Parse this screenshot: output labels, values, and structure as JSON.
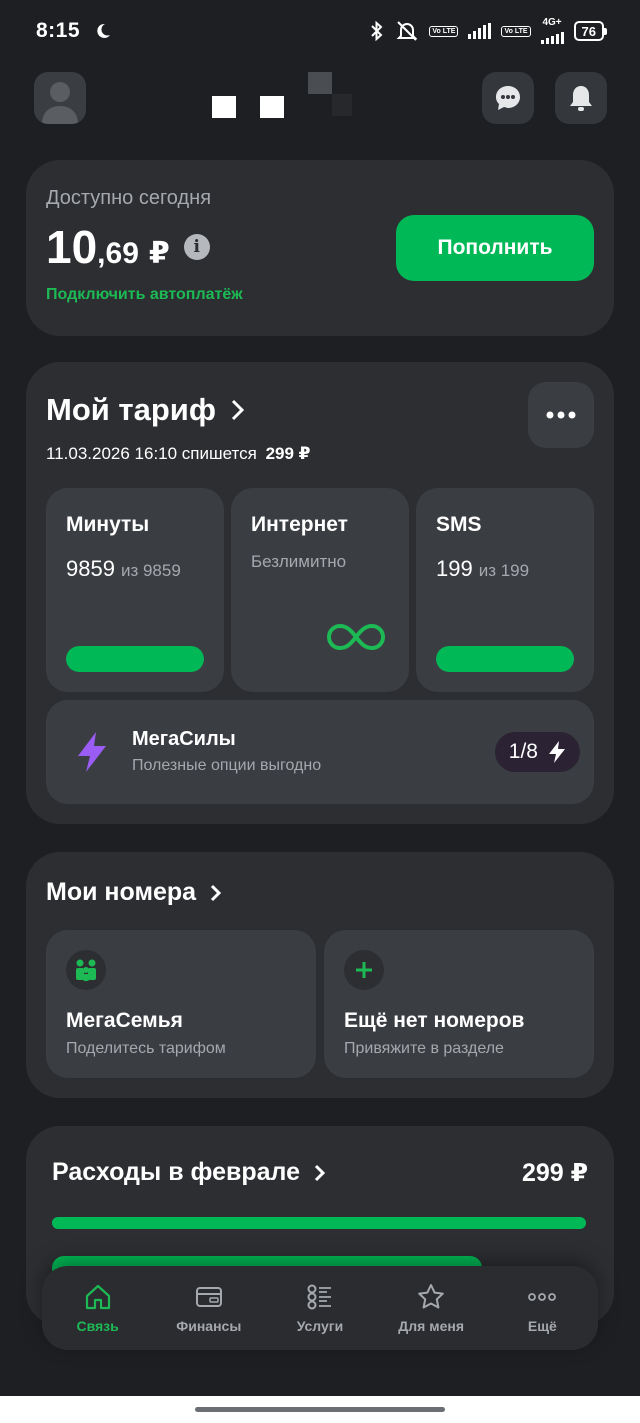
{
  "status_bar": {
    "time": "8:15",
    "volte_1": "Vo LTE",
    "volte_2": "Vo LTE",
    "network": "4G+",
    "battery": "76"
  },
  "header": {
    "avatar_icon": "user-avatar-icon",
    "chat_icon": "chat-bubble-icon",
    "bell_icon": "bell-icon"
  },
  "balance": {
    "label": "Доступно сегодня",
    "amount_int": "10",
    "amount_frac": ",69",
    "currency": "₽",
    "info": "i",
    "autopay_link": "Подключить автоплатёж",
    "topup_label": "Пополнить"
  },
  "tariff": {
    "title": "Мой тариф",
    "charge_text": "11.03.2026 16:10 спишется",
    "charge_amount": "299 ₽",
    "minutes": {
      "title": "Минуты",
      "value": "9859",
      "total": "из 9859",
      "fill": 1.0
    },
    "internet": {
      "title": "Интернет",
      "value": "Безлимитно"
    },
    "sms": {
      "title": "SMS",
      "value": "199",
      "total": "из 199",
      "fill": 1.0
    },
    "megasily": {
      "title": "МегаСилы",
      "subtitle": "Полезные опции выгодно",
      "badge": "1/8"
    }
  },
  "numbers": {
    "title": "Мои номера",
    "family": {
      "title": "МегаСемья",
      "subtitle": "Поделитесь тарифом"
    },
    "add": {
      "title": "Ещё нет номеров",
      "subtitle": "Привяжите в разделе"
    }
  },
  "expenses": {
    "title": "Расходы в феврале",
    "amount": "299 ₽"
  },
  "tabs": [
    {
      "label": "Связь",
      "icon": "home-icon",
      "active": true
    },
    {
      "label": "Финансы",
      "icon": "wallet-icon",
      "active": false
    },
    {
      "label": "Услуги",
      "icon": "services-list-icon",
      "active": false
    },
    {
      "label": "Для меня",
      "icon": "star-icon",
      "active": false
    },
    {
      "label": "Ещё",
      "icon": "more-dots-icon",
      "active": false
    }
  ],
  "colors": {
    "accent": "#00b956",
    "background": "#1e1f22",
    "card": "#2c2e32",
    "tile": "#3a3d42",
    "megasily_icon": "#9b5cf6"
  }
}
